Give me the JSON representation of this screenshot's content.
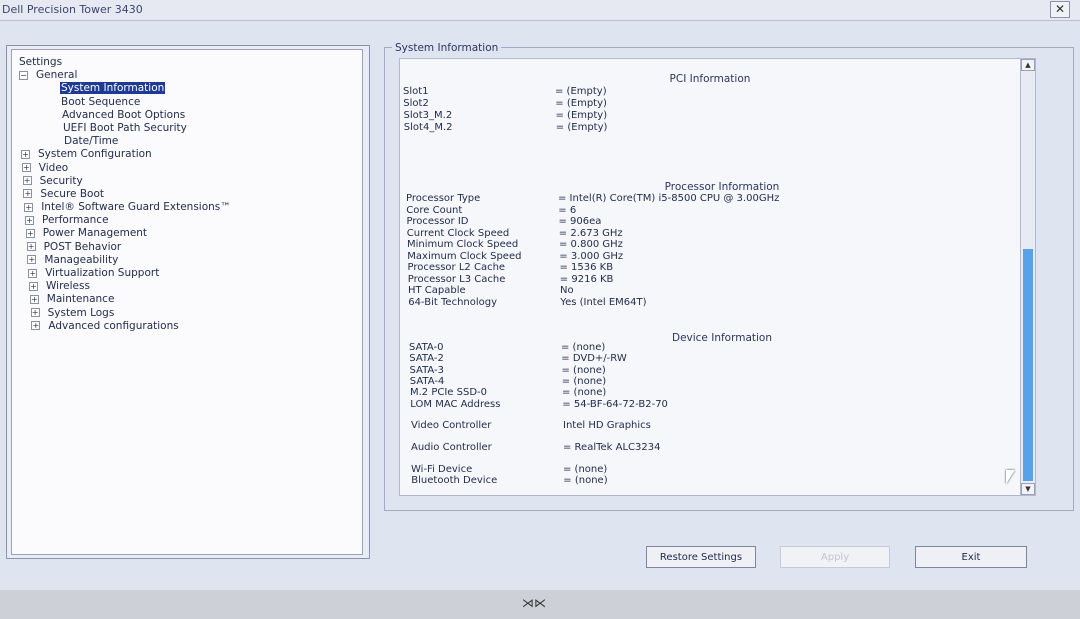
{
  "window": {
    "title": "Dell Precision Tower 3430",
    "close_symbol": "✕"
  },
  "tree": {
    "root": "Settings",
    "general": "General",
    "general_children": [
      "System Information",
      "Boot Sequence",
      "Advanced Boot Options",
      "UEFI Boot Path Security",
      "Date/Time"
    ],
    "sections": [
      "System Configuration",
      "Video",
      "Security",
      "Secure Boot",
      "Intel® Software Guard Extensions™",
      "Performance",
      "Power Management",
      "POST Behavior",
      "Manageability",
      "Virtualization Support",
      "Wireless",
      "Maintenance",
      "System Logs",
      "Advanced configurations"
    ]
  },
  "panel": {
    "group_title": "System Information",
    "pci": {
      "title": "PCI Information",
      "rows": [
        {
          "k": "Slot1",
          "v": "= (Empty)"
        },
        {
          "k": "Slot2",
          "v": "= (Empty)"
        },
        {
          "k": "Slot3_M.2",
          "v": "= (Empty)"
        },
        {
          "k": "Slot4_M.2",
          "v": "= (Empty)"
        }
      ]
    },
    "processor": {
      "title": "Processor Information",
      "rows": [
        {
          "k": "Processor Type",
          "v": "= Intel(R) Core(TM) i5-8500 CPU @ 3.00GHz"
        },
        {
          "k": "Core Count",
          "v": "= 6"
        },
        {
          "k": "Processor ID",
          "v": "= 906ea"
        },
        {
          "k": "Current Clock Speed",
          "v": "= 2.673 GHz"
        },
        {
          "k": "Minimum Clock Speed",
          "v": "= 0.800 GHz"
        },
        {
          "k": "Maximum Clock Speed",
          "v": "= 3.000 GHz"
        },
        {
          "k": "Processor L2 Cache",
          "v": "= 1536 KB"
        },
        {
          "k": "Processor L3 Cache",
          "v": "= 9216 KB"
        },
        {
          "k": "HT Capable",
          "v": "No"
        },
        {
          "k": "64-Bit Technology",
          "v": "Yes (Intel EM64T)"
        }
      ]
    },
    "device": {
      "title": "Device Information",
      "rows": [
        {
          "k": "SATA-0",
          "v": "= (none)"
        },
        {
          "k": "SATA-2",
          "v": "= DVD+/-RW"
        },
        {
          "k": "SATA-3",
          "v": "= (none)"
        },
        {
          "k": "SATA-4",
          "v": "= (none)"
        },
        {
          "k": "M.2 PCIe SSD-0",
          "v": "= (none)"
        },
        {
          "k": "LOM MAC Address",
          "v": "= 54-BF-64-72-B2-70"
        }
      ],
      "video": {
        "k": "Video Controller",
        "v": "Intel HD Graphics"
      },
      "audio": {
        "k": "Audio Controller",
        "v": "= RealTek ALC3234"
      },
      "wireless_rows": [
        {
          "k": "Wi-Fi Device",
          "v": "= (none)"
        },
        {
          "k": "Bluetooth Device",
          "v": "= (none)"
        }
      ]
    }
  },
  "buttons": {
    "restore": "Restore Settings",
    "apply": "Apply",
    "exit": "Exit"
  },
  "scroll_position": 0.46
}
